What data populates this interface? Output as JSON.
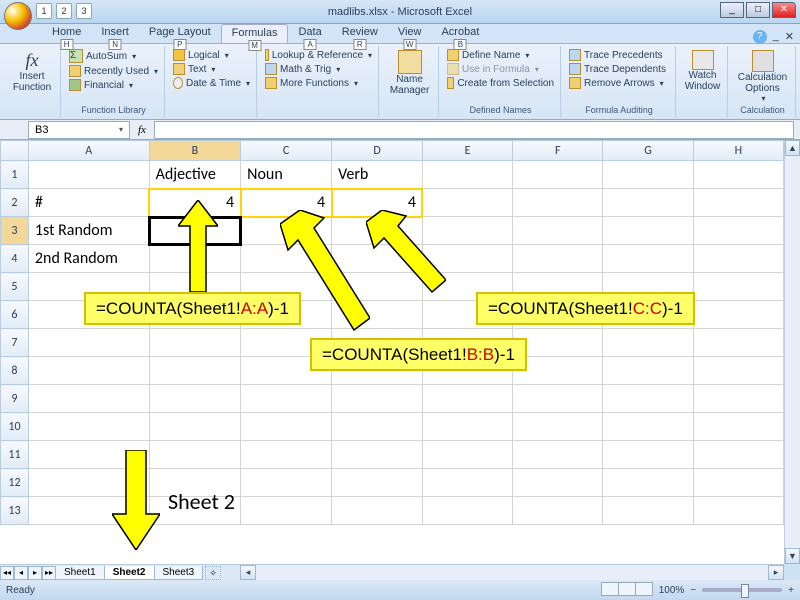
{
  "window": {
    "title": "madlibs.xlsx - Microsoft Excel"
  },
  "qat": [
    "1",
    "2",
    "3"
  ],
  "tabs": [
    {
      "label": "Home",
      "key": "H"
    },
    {
      "label": "Insert",
      "key": "N"
    },
    {
      "label": "Page Layout",
      "key": "P"
    },
    {
      "label": "Formulas",
      "key": "M",
      "active": true
    },
    {
      "label": "Data",
      "key": "A"
    },
    {
      "label": "Review",
      "key": "R"
    },
    {
      "label": "View",
      "key": "W"
    },
    {
      "label": "Acrobat",
      "key": "B"
    }
  ],
  "ribbon": {
    "insert_fn": "Insert Function",
    "autosum": "AutoSum",
    "recent": "Recently Used",
    "financial": "Financial",
    "logical": "Logical",
    "text": "Text",
    "datetime": "Date & Time",
    "lookup": "Lookup & Reference",
    "mathtrig": "Math & Trig",
    "more": "More Functions",
    "group1": "Function Library",
    "name_mgr": "Name Manager",
    "define": "Define Name",
    "usein": "Use in Formula",
    "createfrom": "Create from Selection",
    "group2": "Defined Names",
    "precedents": "Trace Precedents",
    "dependents": "Trace Dependents",
    "remove": "Remove Arrows",
    "group3": "Formula Auditing",
    "watch": "Watch Window",
    "calc": "Calculation Options",
    "group4": "Calculation"
  },
  "namebox": "B3",
  "columns": [
    "A",
    "B",
    "C",
    "D",
    "E",
    "F",
    "G",
    "H"
  ],
  "rows": [
    "1",
    "2",
    "3",
    "4",
    "5",
    "6",
    "7",
    "8",
    "9",
    "10",
    "11",
    "12",
    "13"
  ],
  "cells": {
    "B1": "Adjective",
    "C1": "Noun",
    "D1": "Verb",
    "A2": "#",
    "B2": "4",
    "C2": "4",
    "D2": "4",
    "A3": "1st Random",
    "A4": "2nd Random"
  },
  "callouts": {
    "c1_pre": "=COUNTA(Sheet1!",
    "c1_ref": "A:A",
    "c1_post": ")-1",
    "c2_pre": "=COUNTA(Sheet1!",
    "c2_ref": "B:B",
    "c2_post": ")-1",
    "c3_pre": "=COUNTA(Sheet1!",
    "c3_ref": "C:C",
    "c3_post": ")-1",
    "sheet_label": "Sheet 2"
  },
  "sheet_tabs": [
    "Sheet1",
    "Sheet2",
    "Sheet3"
  ],
  "status": {
    "ready": "Ready",
    "zoom": "100%"
  }
}
